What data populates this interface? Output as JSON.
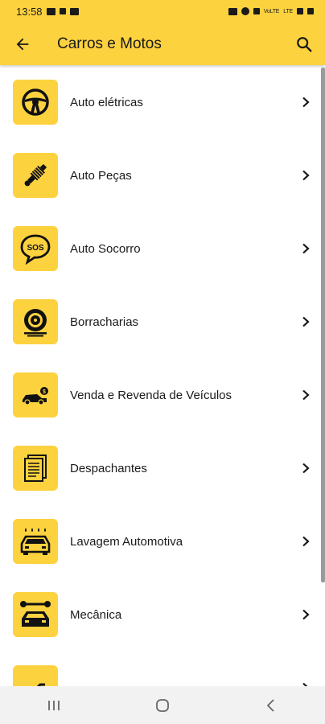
{
  "status_bar": {
    "time": "13:58",
    "net_labels": [
      "VoLTE",
      "LTE"
    ]
  },
  "app_bar": {
    "title": "Carros e Motos"
  },
  "items": [
    {
      "label": "Auto elétricas",
      "icon": "steering-wheel-icon"
    },
    {
      "label": "Auto Peças",
      "icon": "shock-absorber-icon"
    },
    {
      "label": "Auto Socorro",
      "icon": "sos-icon"
    },
    {
      "label": "Borracharias",
      "icon": "tire-icon"
    },
    {
      "label": "Venda e Revenda de Veículos",
      "icon": "car-sale-icon"
    },
    {
      "label": "Despachantes",
      "icon": "documents-icon"
    },
    {
      "label": "Lavagem Automotiva",
      "icon": "car-wash-icon"
    },
    {
      "label": "Mecânica",
      "icon": "mechanic-icon"
    },
    {
      "label": "",
      "icon": "motorcycle-icon"
    }
  ],
  "colors": {
    "accent": "#fdd23f",
    "text": "#1a1a1a",
    "nav_bg": "#f2f2f2"
  }
}
